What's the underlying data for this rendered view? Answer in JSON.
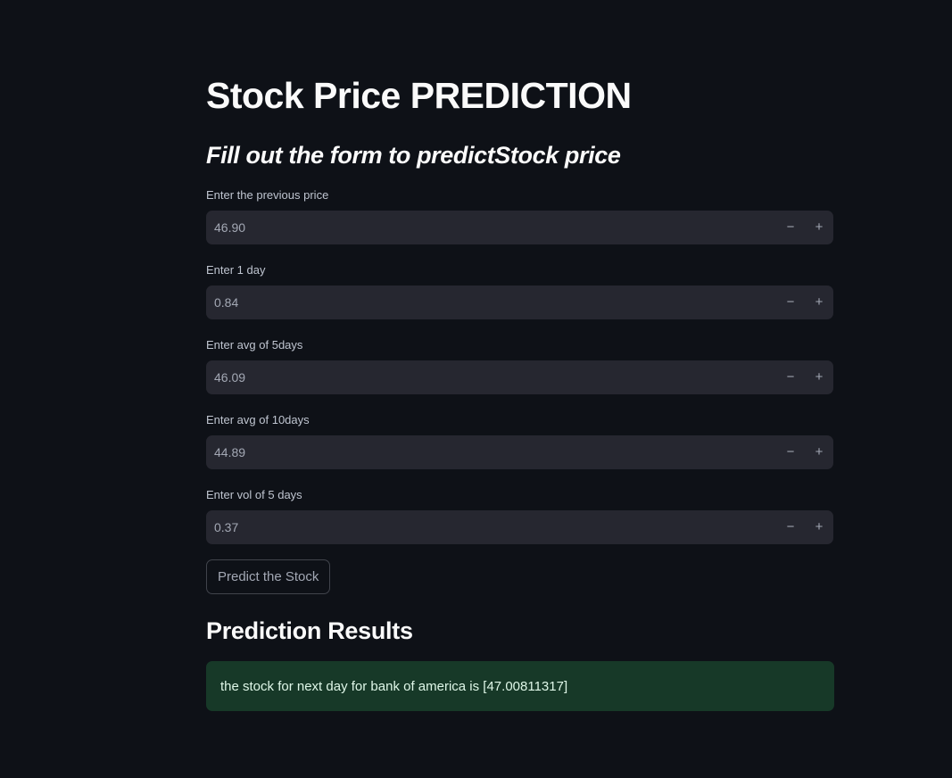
{
  "page": {
    "title": "Stock Price PREDICTION",
    "subtitle": "Fill out the form to predictStock price"
  },
  "form": {
    "fields": [
      {
        "label": "Enter the previous price",
        "value": "46.90",
        "decrement": "−",
        "increment": "+"
      },
      {
        "label": "Enter 1 day",
        "value": "0.84",
        "decrement": "−",
        "increment": "+"
      },
      {
        "label": "Enter avg of 5days",
        "value": "46.09",
        "decrement": "−",
        "increment": "+"
      },
      {
        "label": "Enter avg of 10days",
        "value": "44.89",
        "decrement": "−",
        "increment": "+"
      },
      {
        "label": "Enter vol of 5 days",
        "value": "0.37",
        "decrement": "−",
        "increment": "+"
      }
    ],
    "submit_label": "Predict the Stock"
  },
  "results": {
    "title": "Prediction Results",
    "message": "the stock for next day for bank of america is [47.00811317]"
  },
  "colors": {
    "background": "#0e1117",
    "input_background": "#262730",
    "success_background": "#173928",
    "text": "#fafafa"
  }
}
